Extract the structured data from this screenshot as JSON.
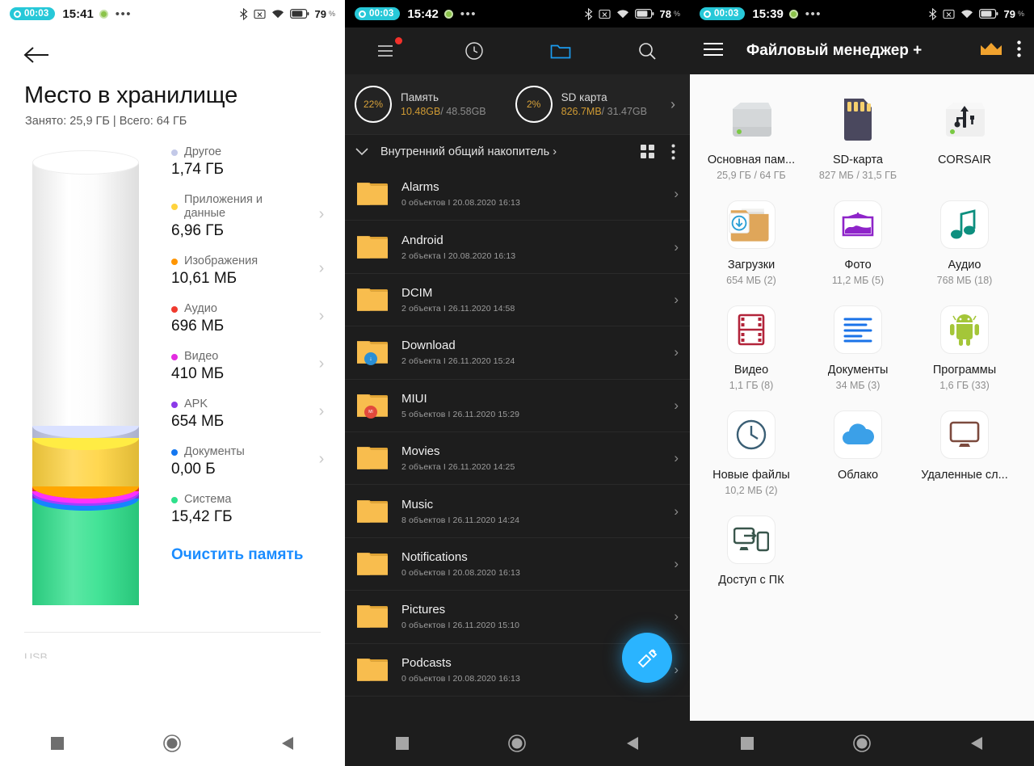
{
  "panel1": {
    "statusbar": {
      "rec": "00:03",
      "time": "15:41",
      "dots": "•••",
      "battery": "79",
      "pct": "%"
    },
    "back_icon": "arrow-left-icon",
    "title": "Место в хранилище",
    "subtitle": "Занято: 25,9 ГБ | Всего: 64 ГБ",
    "legend": [
      {
        "name": "Другое",
        "value": "1,74 ГБ",
        "color": "#c3c9e8",
        "chevron": false
      },
      {
        "name": "Приложения и данные",
        "value": "6,96 ГБ",
        "color": "#ffd33d",
        "chevron": true
      },
      {
        "name": "Изображения",
        "value": "10,61 МБ",
        "color": "#ff9500",
        "chevron": true
      },
      {
        "name": "Аудио",
        "value": "696 МБ",
        "color": "#f03a2e",
        "chevron": true
      },
      {
        "name": "Видео",
        "value": "410 МБ",
        "color": "#e32ce0",
        "chevron": true
      },
      {
        "name": "APK",
        "value": "654 МБ",
        "color": "#8b3ae8",
        "chevron": true
      },
      {
        "name": "Документы",
        "value": "0,00 Б",
        "color": "#1477f0",
        "chevron": true
      },
      {
        "name": "Система",
        "value": "15,42 ГБ",
        "color": "#2ee08b",
        "chevron": false
      }
    ],
    "clear_label": "Очистить память",
    "cut_row": "USB",
    "navbar": [
      "recents-icon",
      "home-icon",
      "back-icon"
    ]
  },
  "panel2": {
    "statusbar": {
      "rec": "00:03",
      "time": "15:42",
      "dots": "•••",
      "battery": "78",
      "pct": "%"
    },
    "toolbar": [
      "menu-icon",
      "clock-icon",
      "folder-icon",
      "search-icon"
    ],
    "storage": [
      {
        "percent": "22%",
        "name": "Память",
        "used": "10.48GB",
        "total": "/ 48.58GB",
        "ratio": 0.22
      },
      {
        "percent": "2%",
        "name": "SD карта",
        "used": "826.7MB",
        "total": "/ 31.47GB",
        "ratio": 0.02
      }
    ],
    "breadcrumb": "Внутренний общий накопитель",
    "files": [
      {
        "name": "Alarms",
        "meta": "0 объектов  I  20.08.2020 16:13",
        "overlay": ""
      },
      {
        "name": "Android",
        "meta": "2 объекта  I  20.08.2020 16:13",
        "overlay": ""
      },
      {
        "name": "DCIM",
        "meta": "2 объекта  I  26.11.2020 14:58",
        "overlay": ""
      },
      {
        "name": "Download",
        "meta": "2 объекта  I  26.11.2020 15:24",
        "overlay": "download"
      },
      {
        "name": "MIUI",
        "meta": "5 объектов  I  26.11.2020 15:29",
        "overlay": "miui"
      },
      {
        "name": "Movies",
        "meta": "2 объекта  I  26.11.2020 14:25",
        "overlay": ""
      },
      {
        "name": "Music",
        "meta": "8 объектов  I  26.11.2020 14:24",
        "overlay": ""
      },
      {
        "name": "Notifications",
        "meta": "0 объектов  I  20.08.2020 16:13",
        "overlay": ""
      },
      {
        "name": "Pictures",
        "meta": "0 объектов  I  26.11.2020 15:10",
        "overlay": ""
      },
      {
        "name": "Podcasts",
        "meta": "0 объектов  I  20.08.2020 16:13",
        "overlay": ""
      }
    ],
    "fab_icon": "cleaner-brush-icon",
    "navbar": [
      "recents-icon",
      "home-icon",
      "back-icon"
    ]
  },
  "panel3": {
    "statusbar": {
      "rec": "00:03",
      "time": "15:39",
      "dots": "•••",
      "battery": "79",
      "pct": "%"
    },
    "appbar": {
      "menu_icon": "hamburger-icon",
      "title": "Файловый менеджер +",
      "crown_icon": "crown-icon",
      "more_icon": "overflow-menu-icon"
    },
    "grid": [
      {
        "label": "Основная пам...",
        "sub": "25,9 ГБ / 64 ГБ",
        "icon": "hard-drive-icon"
      },
      {
        "label": "SD-карта",
        "sub": "827 МБ / 31,5 ГБ",
        "icon": "sd-card-icon"
      },
      {
        "label": "CORSAIR",
        "sub": "",
        "icon": "usb-drive-icon"
      },
      {
        "label": "Загрузки",
        "sub": "654 МБ (2)",
        "icon": "downloads-folder-icon"
      },
      {
        "label": "Фото",
        "sub": "11,2 МБ (5)",
        "icon": "photo-icon"
      },
      {
        "label": "Аудио",
        "sub": "768 МБ (18)",
        "icon": "audio-note-icon"
      },
      {
        "label": "Видео",
        "sub": "1,1 ГБ (8)",
        "icon": "video-film-icon"
      },
      {
        "label": "Документы",
        "sub": "34 МБ (3)",
        "icon": "documents-icon"
      },
      {
        "label": "Программы",
        "sub": "1,6 ГБ (33)",
        "icon": "android-apps-icon"
      },
      {
        "label": "Новые файлы",
        "sub": "10,2 МБ (2)",
        "icon": "clock-recent-icon"
      },
      {
        "label": "Облако",
        "sub": "",
        "icon": "cloud-icon"
      },
      {
        "label": "Удаленные сл...",
        "sub": "",
        "icon": "remote-monitor-icon"
      },
      {
        "label": "Доступ с ПК",
        "sub": "",
        "icon": "pc-access-icon"
      }
    ],
    "navbar": [
      "recents-icon",
      "home-icon",
      "back-icon"
    ]
  },
  "chart_data": {
    "type": "bar",
    "title": "Место в хранилище",
    "subtitle": "Занято: 25,9 ГБ | Всего: 64 ГБ",
    "unit": "GB",
    "total": 64,
    "used": 25.9,
    "categories": [
      "Другое",
      "Приложения и данные",
      "Изображения",
      "Аудио",
      "Видео",
      "APK",
      "Документы",
      "Система"
    ],
    "values": [
      1.74,
      6.96,
      0.01061,
      0.696,
      0.41,
      0.654,
      0.0,
      15.42
    ],
    "labels": [
      "1,74 ГБ",
      "6,96 ГБ",
      "10,61 МБ",
      "696 МБ",
      "410 МБ",
      "654 МБ",
      "0,00 Б",
      "15,42 ГБ"
    ],
    "colors": [
      "#c3c9e8",
      "#ffd33d",
      "#ff9500",
      "#f03a2e",
      "#e32ce0",
      "#8b3ae8",
      "#1477f0",
      "#2ee08b"
    ],
    "xlabel": "",
    "ylabel": "",
    "ylim": [
      0,
      64
    ],
    "grid": false,
    "legend": "right"
  }
}
